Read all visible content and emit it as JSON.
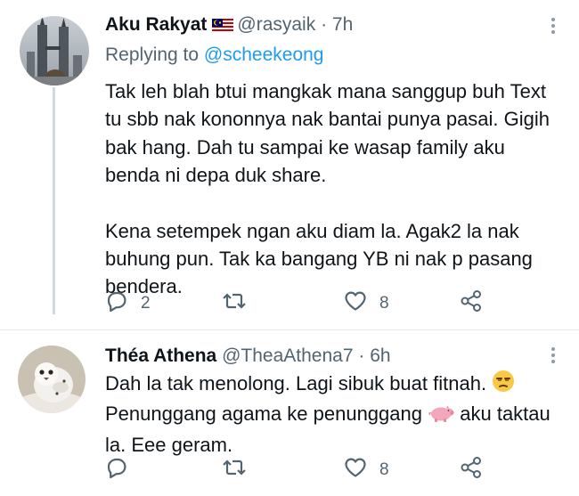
{
  "tweets": [
    {
      "author_name": "Aku Rakyat",
      "handle": "@rasyaik",
      "time": "7h",
      "separator": "·",
      "replying_prefix": "Replying to",
      "replying_handle": "@scheekeong",
      "paragraphs": [
        "Tak leh blah btui mangkak mana sanggup buh Text tu sbb nak kononnya nak bantai punya pasai. Gigih bak hang. Dah tu sampai ke wasap family aku benda ni depa duk share.",
        "Kena setempek ngan aku diam la. Agak2 la nak buhung pun. Tak ka bangang YB ni nak p pasang bendera."
      ],
      "replies": "2",
      "retweets": "",
      "likes": "8",
      "flag_icon": "malaysia-flag-icon"
    },
    {
      "author_name": "Théa Athena",
      "handle": "@TheaAthena7",
      "time": "6h",
      "separator": "·",
      "line1": "Dah la tak menolong. Lagi sibuk buat fitnah.",
      "line2a": "Penunggang agama ke penunggang",
      "line2b": "aku taktau",
      "line3": "la. Eee geram.",
      "replies": "",
      "retweets": "",
      "likes": "8",
      "emoji_1": "unamused-face-icon",
      "emoji_2": "pig-icon"
    }
  ],
  "colors": {
    "link": "#1d9bf0",
    "secondary_text": "#536471",
    "primary_text": "#0f1419",
    "thread_line": "#cfd9de"
  }
}
